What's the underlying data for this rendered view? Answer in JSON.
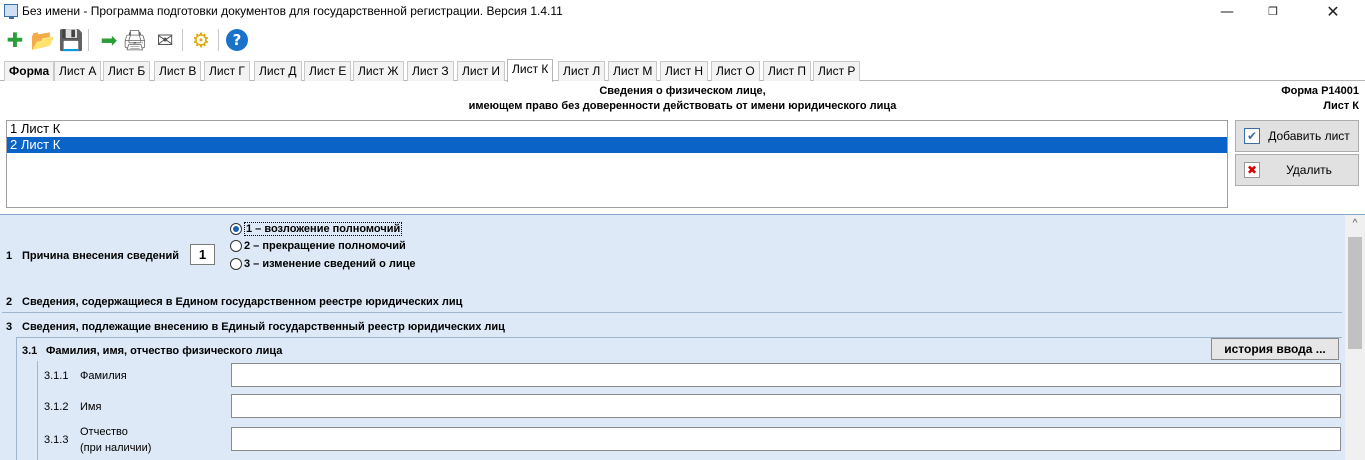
{
  "window": {
    "title": "Без имени - Программа подготовки документов для государственной регистрации. Версия 1.4.11",
    "minimize": "—",
    "maximize": "❐",
    "close": "✕"
  },
  "toolbar": {
    "buttons": [
      {
        "name": "new-document-icon",
        "glyph": "✚",
        "color": "#2e9e3c"
      },
      {
        "name": "open-folder-icon",
        "glyph": "📂",
        "color": "#e0a800"
      },
      {
        "name": "save-icon",
        "glyph": "💾",
        "color": "#3a6ea5"
      },
      {
        "name": "export-icon",
        "glyph": "➡",
        "color": "#2e9e3c"
      },
      {
        "name": "print-icon",
        "glyph": "🖨",
        "color": "#666666"
      },
      {
        "name": "mail-icon",
        "glyph": "✉",
        "color": "#555555"
      },
      {
        "name": "settings-icon",
        "glyph": "⚙",
        "color": "#e0a800"
      },
      {
        "name": "help-icon",
        "glyph": "?",
        "color": "#1a73c8"
      }
    ]
  },
  "tabs": [
    "Форма",
    "Лист А",
    "Лист Б",
    "Лист В",
    "Лист Г",
    "Лист Д",
    "Лист Е",
    "Лист Ж",
    "Лист З",
    "Лист И",
    "Лист К",
    "Лист Л",
    "Лист М",
    "Лист Н",
    "Лист О",
    "Лист П",
    "Лист Р"
  ],
  "active_tab": "Лист К",
  "header": {
    "line1": "Сведения о физическом лице,",
    "line2": "имеющем право без доверенности действовать от имени юридического лица",
    "form_code": "Форма Р14001",
    "sheet_code": "Лист К"
  },
  "sheet_list": {
    "items": [
      "1 Лист К",
      "2 Лист К"
    ],
    "selected_index": 1
  },
  "buttons": {
    "add_sheet": "Добавить лист",
    "delete": "Удалить",
    "history": "история ввода ..."
  },
  "section1": {
    "number": "1",
    "label": "Причина внесения сведений",
    "code_value": "1",
    "options": [
      "1 – возложение полномочий",
      "2 – прекращение полномочий",
      "3 – изменение сведений о лице"
    ],
    "selected_option": 0
  },
  "section2": {
    "number": "2",
    "label": "Сведения, содержащиеся в Едином государственном реестре юридических лиц"
  },
  "section3": {
    "number": "3",
    "label": "Сведения, подлежащие внесению в Единый государственный реестр юридических лиц"
  },
  "section31": {
    "number": "3.1",
    "label": "Фамилия, имя, отчество физического лица"
  },
  "fields": [
    {
      "number": "3.1.1",
      "label": "Фамилия",
      "sublabel": "",
      "value": ""
    },
    {
      "number": "3.1.2",
      "label": "Имя",
      "sublabel": "",
      "value": ""
    },
    {
      "number": "3.1.3",
      "label": "Отчество",
      "sublabel": "(при наличии)",
      "value": ""
    }
  ]
}
